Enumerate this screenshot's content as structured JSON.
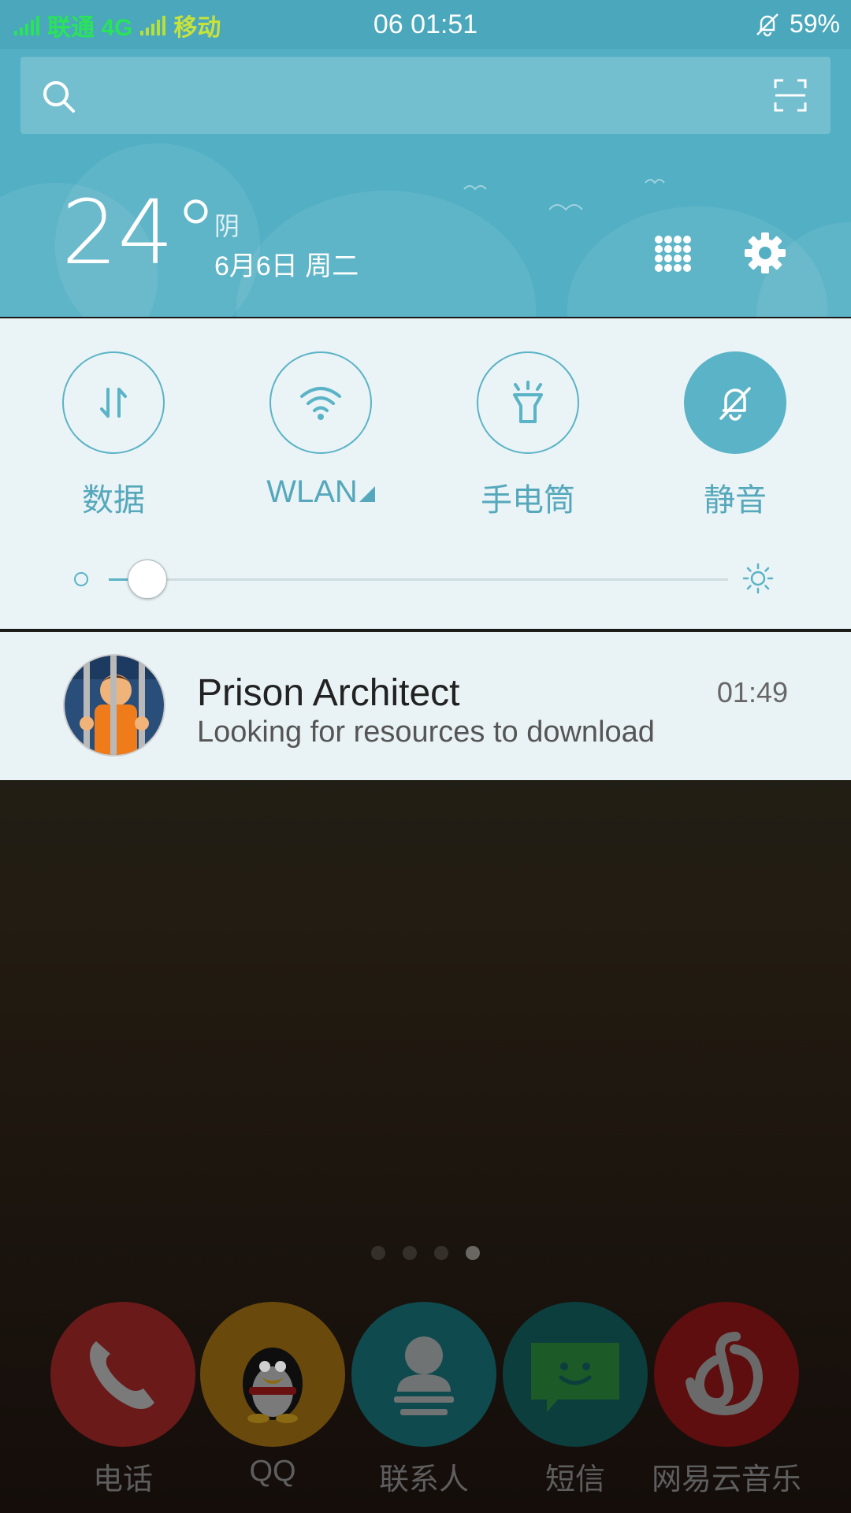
{
  "status_bar": {
    "carrier1": "联通 4G",
    "carrier2": "移动",
    "time": "06  01:51",
    "battery": "59%"
  },
  "search": {
    "placeholder": ""
  },
  "weather": {
    "temperature": "24°",
    "condition": "阴",
    "date": "6月6日 周二"
  },
  "quick_settings": {
    "toggles": [
      {
        "label": "数据",
        "icon": "data-icon",
        "on": false
      },
      {
        "label": "WLAN",
        "icon": "wifi-icon",
        "on": false
      },
      {
        "label": "手电筒",
        "icon": "flashlight-icon",
        "on": false
      },
      {
        "label": "静音",
        "icon": "mute-icon",
        "on": true
      }
    ],
    "brightness": {
      "level": 0.05
    }
  },
  "notification": {
    "title": "Prison Architect",
    "time": "01:49",
    "body": "Looking for resources to download"
  },
  "home": {
    "pages": 4,
    "active_page": 4,
    "dock": [
      {
        "label": "电话",
        "icon": "phone-icon",
        "color": "#6b1a1a"
      },
      {
        "label": "QQ",
        "icon": "qq-penguin-icon",
        "color": "#6a4a0c"
      },
      {
        "label": "联系人",
        "icon": "contacts-icon",
        "color": "#0f4a4e"
      },
      {
        "label": "短信",
        "icon": "sms-icon",
        "color": "#0c3e3e"
      },
      {
        "label": "网易云音乐",
        "icon": "netease-music-icon",
        "color": "#5e0e0e"
      }
    ]
  },
  "colors": {
    "accent": "#5ab3c6",
    "header": "#52afc4"
  }
}
